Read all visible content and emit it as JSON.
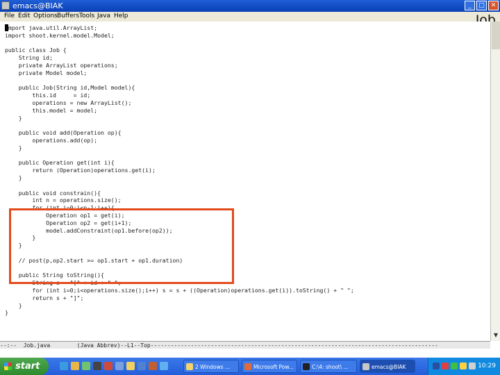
{
  "window": {
    "title": "emacs@BIAK"
  },
  "overlay_title": "Job",
  "menu": [
    "File",
    "Edit",
    "Options",
    "Buffers",
    "Tools",
    "Java",
    "Help"
  ],
  "code_lines": [
    "import java.util.ArrayList;",
    "import shoot.kernel.model.Model;",
    "",
    "public class Job {",
    "    String id;",
    "    private ArrayList operations;",
    "    private Model model;",
    "",
    "    public Job(String id,Model model){",
    "        this.id     = id;",
    "        operations = new ArrayList();",
    "        this.model = model;",
    "    }",
    "",
    "    public void add(Operation op){",
    "        operations.add(op);",
    "    }",
    "",
    "    public Operation get(int i){",
    "        return (Operation)operations.get(i);",
    "    }",
    "",
    "    public void constrain(){",
    "        int n = operations.size();",
    "        for (int i=0;i<n-1;i++){",
    "            Operation op1 = get(i);",
    "            Operation op2 = get(i+1);",
    "            model.addConstraint(op1.before(op2));",
    "        }",
    "    }",
    "",
    "    // post(p,op2.start >= op1.start + op1.duration)",
    "",
    "    public String toString(){",
    "        String s = \"[\" + id + \" \";",
    "        for (int i=0;i<operations.size();i++) s = s + ((Operation)operations.get(i)).toString() + \" \";",
    "        return s + \"]\";",
    "    }",
    "}"
  ],
  "modeline": "--:--  Job.java        (Java Abbrev)--L1--Top--------------------------------------------------------------------------------------",
  "taskbar": {
    "start_label": "start",
    "tasks": [
      "2 Windows ...",
      "Microsoft Pow...",
      "C:\\4: shoot\\ ...",
      "emacs@BIAK"
    ],
    "clock": "10:29"
  },
  "colors": {
    "highlight": "#e24a1a",
    "titlebar": "#0a3fb5",
    "taskbar": "#245edb",
    "start": "#2d8a2d"
  }
}
